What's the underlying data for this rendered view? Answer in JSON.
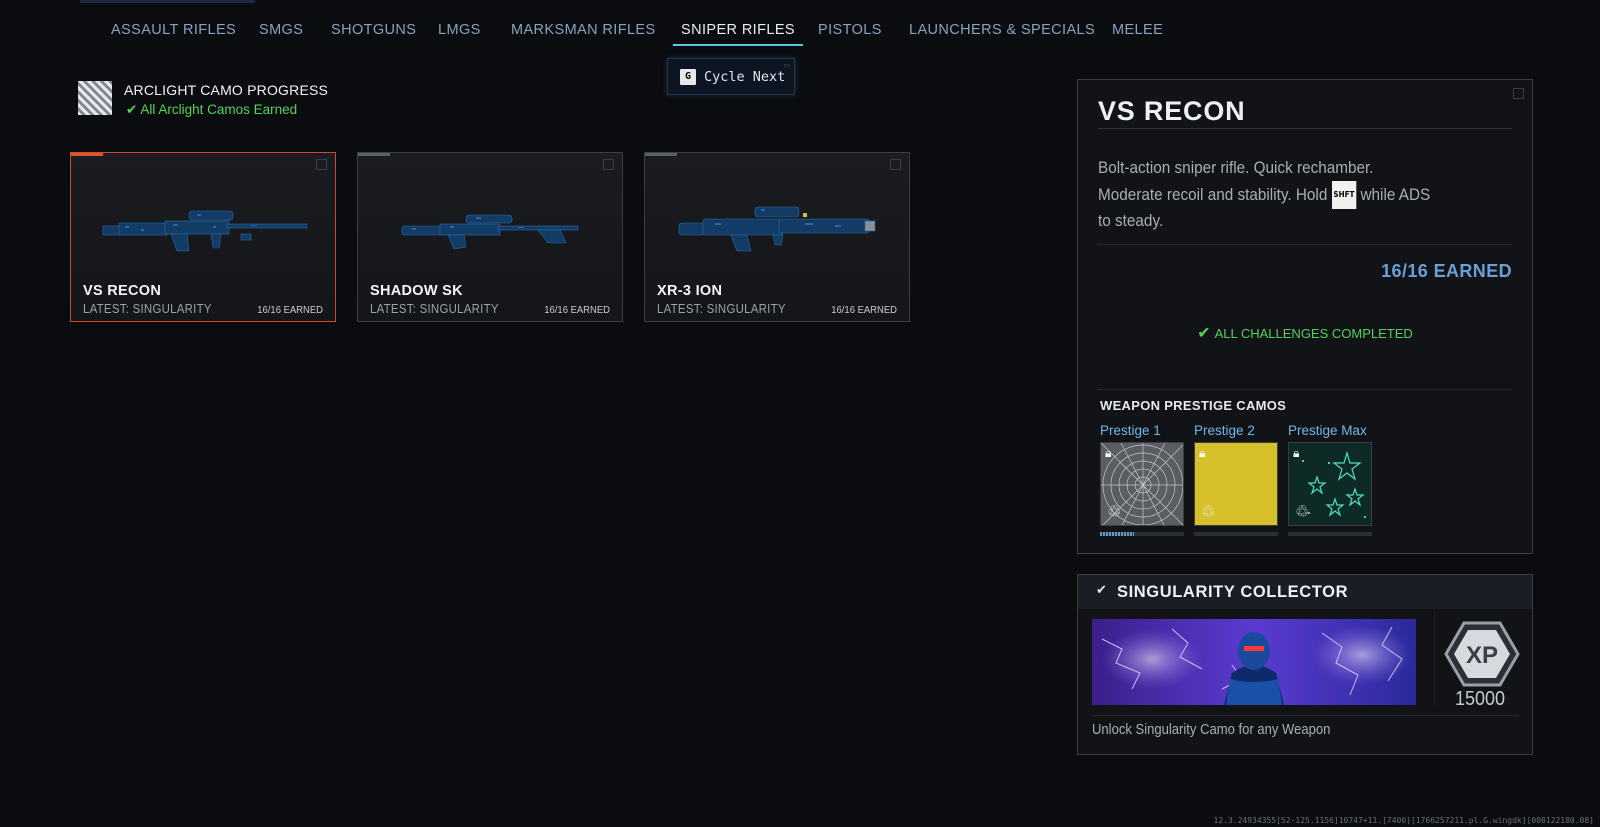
{
  "tabs": [
    {
      "label": "ASSAULT RIFLES",
      "active": false
    },
    {
      "label": "SMGS",
      "active": false
    },
    {
      "label": "SHOTGUNS",
      "active": false
    },
    {
      "label": "LMGS",
      "active": false
    },
    {
      "label": "MARKSMAN RIFLES",
      "active": false
    },
    {
      "label": "SNIPER RIFLES",
      "active": true
    },
    {
      "label": "PISTOLS",
      "active": false
    },
    {
      "label": "LAUNCHERS & SPECIALS",
      "active": false
    },
    {
      "label": "MELEE",
      "active": false
    }
  ],
  "cycle": {
    "key": "G",
    "label": "Cycle Next"
  },
  "camo_progress": {
    "title": "ARCLIGHT CAMO PROGRESS",
    "status": "All Arclight Camos Earned"
  },
  "weapons": [
    {
      "name": "VS RECON",
      "latest": "LATEST: SINGULARITY",
      "earned": "16/16 EARNED",
      "selected": true
    },
    {
      "name": "SHADOW SK",
      "latest": "LATEST: SINGULARITY",
      "earned": "16/16 EARNED",
      "selected": false
    },
    {
      "name": "XR-3 ION",
      "latest": "LATEST: SINGULARITY",
      "earned": "16/16 EARNED",
      "selected": false
    }
  ],
  "detail": {
    "title": "VS RECON",
    "desc_part1": "Bolt-action sniper rifle.  Quick rechamber.",
    "desc_part2": "Moderate recoil and stability.  Hold ",
    "desc_key": "SHFT",
    "desc_part3": " while ADS",
    "desc_part4": "to steady.",
    "earned": "16/16 EARNED",
    "challenges": "ALL CHALLENGES COMPLETED",
    "prestige_title": "WEAPON PRESTIGE CAMOS",
    "prestige": [
      {
        "label": "Prestige 1",
        "progress": 0.4
      },
      {
        "label": "Prestige 2",
        "progress": 0
      },
      {
        "label": "Prestige Max",
        "progress": 0
      }
    ]
  },
  "collector": {
    "title": "SINGULARITY COLLECTOR",
    "xp_badge": "XP",
    "xp_value": "15000",
    "unlock_text": "Unlock Singularity Camo for any Weapon"
  },
  "build_string": "12.3.24934355[52-125.1156]10747+11.[7400][1766257211.pl.G.wingdk][000122180.08]"
}
